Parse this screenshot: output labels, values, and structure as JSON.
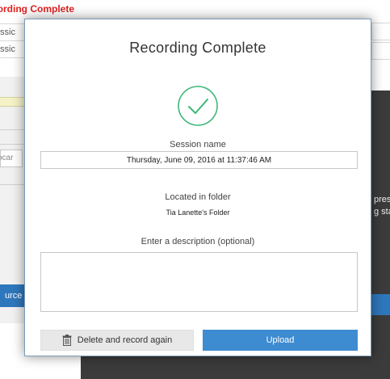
{
  "background": {
    "title_fragment": "cording Complete",
    "row_a_fragment": "ssic",
    "row_b_fragment": "ssic",
    "input_fragment": "bcar",
    "button_fragment": "urce",
    "dark_text_line1": "pres",
    "dark_text_line2": "g sta"
  },
  "dialog": {
    "title": "Recording Complete",
    "success_icon": "checkmark-circle-icon",
    "session_label": "Session name",
    "session_value": "Thursday, June 09, 2016 at 11:37:46 AM",
    "folder_label": "Located in folder",
    "folder_value": "Tia Lanette's Folder",
    "description_label": "Enter a description (optional)",
    "description_value": "",
    "delete_button_label": "Delete and record again",
    "delete_button_icon": "trash-icon",
    "upload_button_label": "Upload"
  },
  "colors": {
    "accent": "#3d8bd1",
    "check_green": "#3cb878",
    "background_title": "#e02020",
    "overlay_dark": "#3b3b3b"
  }
}
